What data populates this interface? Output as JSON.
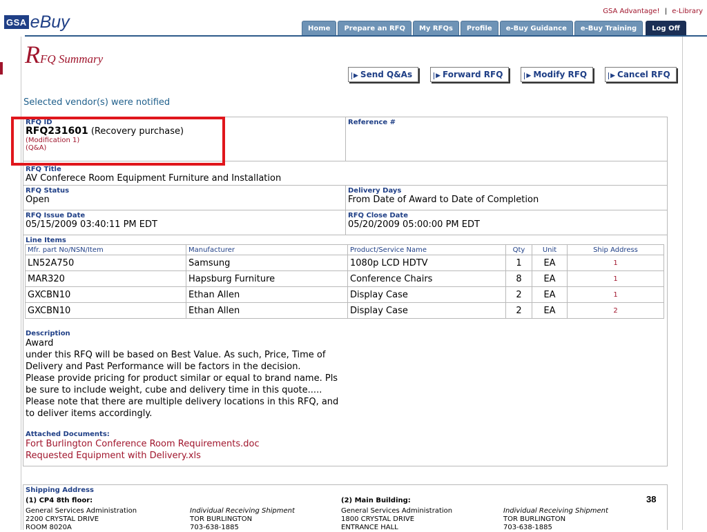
{
  "header": {
    "logo_gsa": "GSA",
    "logo_ebuy": "eBuy",
    "top_links": [
      "GSA Advantage!",
      "e-Library"
    ],
    "top_link_sep": "|",
    "tabs": [
      "Home",
      "Prepare an RFQ",
      "My RFQs",
      "Profile",
      "e-Buy Guidance",
      "e-Buy Training"
    ],
    "logoff": "Log Off"
  },
  "page": {
    "title_initial": "R",
    "title_rest": "FQ Summary",
    "notice": "Selected vendor(s) were notified"
  },
  "actions": [
    "Send Q&As",
    "Forward RFQ",
    "Modify RFQ",
    "Cancel RFQ"
  ],
  "summary": {
    "rfq_id_label": "RFQ ID",
    "rfq_id": "RFQ231601",
    "rfq_id_note": " (Recovery purchase)",
    "modification": "(Modification 1)",
    "qa": "(Q&A)",
    "reference_label": "Reference #",
    "reference_value": "",
    "title_label": "RFQ Title",
    "title_value": "AV Conferece Room Equipment Furniture and Installation",
    "status_label": "RFQ Status",
    "status_value": "Open",
    "delivery_label": "Delivery Days",
    "delivery_value": "From Date of Award to Date of Completion",
    "issue_label": "RFQ Issue Date",
    "issue_value": "05/15/2009 03:40:11 PM EDT",
    "close_label": "RFQ Close Date",
    "close_value": "05/20/2009 05:00:00 PM EDT"
  },
  "line_items": {
    "label": "Line Items",
    "columns": [
      "Mfr. part No/NSN/Item",
      "Manufacturer",
      "Product/Service Name",
      "Qty",
      "Unit",
      "Ship Address"
    ],
    "rows": [
      [
        "LN52A750",
        "Samsung",
        "1080p LCD HDTV",
        "1",
        "EA",
        "1"
      ],
      [
        "MAR320",
        "Hapsburg Furniture",
        "Conference Chairs",
        "8",
        "EA",
        "1"
      ],
      [
        "GXCBN10",
        "Ethan Allen",
        "Display Case",
        "2",
        "EA",
        "1"
      ],
      [
        "GXCBN10",
        "Ethan Allen",
        "Display Case",
        "2",
        "EA",
        "2"
      ]
    ]
  },
  "description": {
    "label": "Description",
    "text": "Award\nunder this RFQ will be based on Best Value. As such, Price, Time of\nDelivery and Past Performance will be factors in the decision.\nPlease provide pricing for product similar or equal to brand name. Pls\nbe sure to include weight, cube and delivery time in this quote.....\nPlease note that there are multiple delivery locations in this RFQ, and\nto deliver items accordingly."
  },
  "attachments": {
    "label": "Attached Documents:",
    "files": [
      "Fort Burlington Conference Room Requirements.doc",
      "Requested Equipment with Delivery.xls"
    ]
  },
  "shipping": {
    "label": "Shipping Address",
    "addr1_head_num": "(1)",
    "addr1_head": " CP4 8th floor:",
    "addr1_lines": [
      "General Services Administration",
      "2200 CRYSTAL DRIVE",
      "ROOM 8020A"
    ],
    "addr1_type": "Individual Receiving Shipment",
    "addr1_contact": [
      "TOR BURLINGTON",
      "703-638-1885"
    ],
    "addr2_head_num": "(2)",
    "addr2_head": " Main Building:",
    "addr2_lines": [
      "General Services Administration",
      "1800 CRYSTAL DRIVE",
      "ENTRANCE HALL"
    ],
    "addr2_type": "Individual Receiving Shipment",
    "addr2_contact": [
      "TOR BURLINGTON",
      "703-638-1885"
    ]
  },
  "slide_number": "38"
}
